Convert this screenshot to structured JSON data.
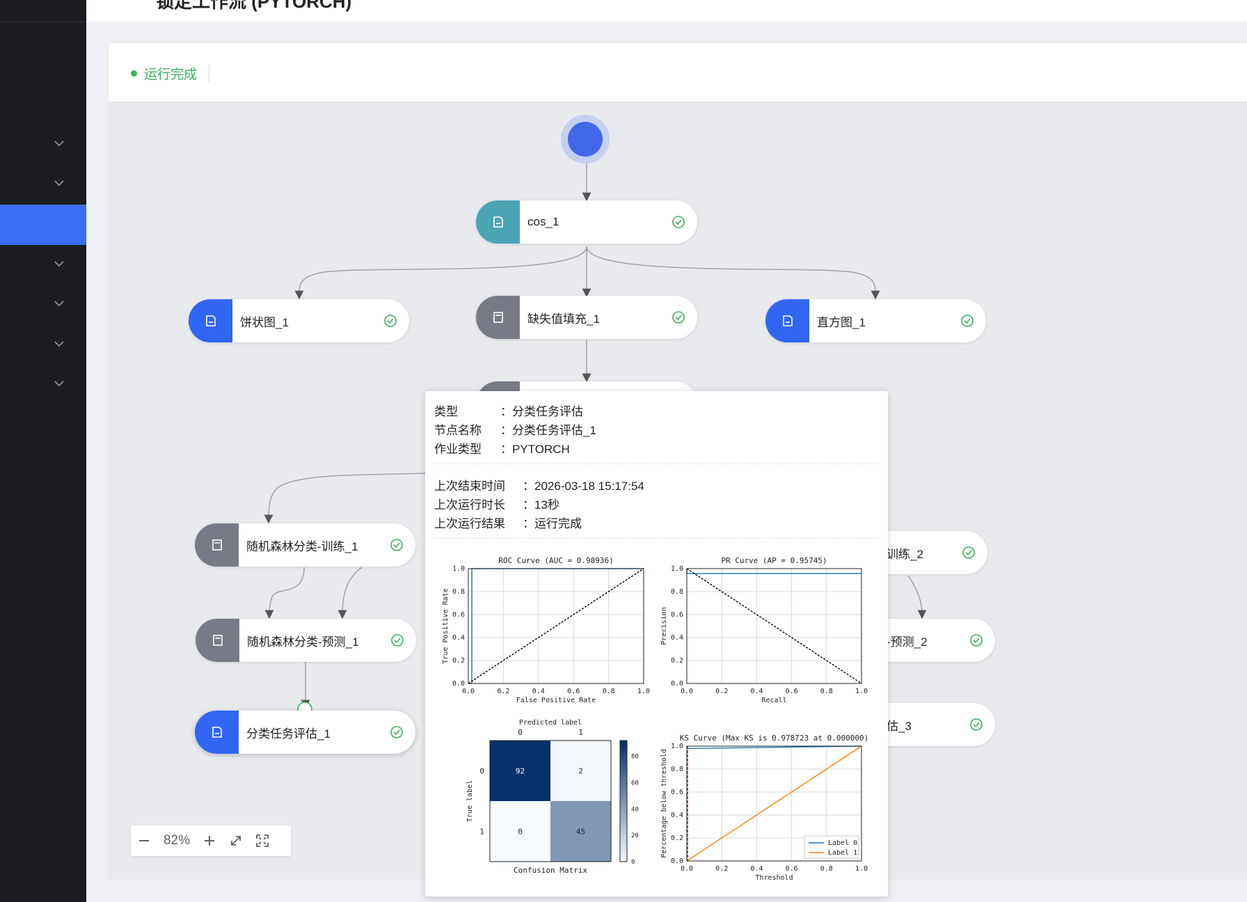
{
  "app": {
    "title_partial": "锁定工作流 (PYTORCH)"
  },
  "sidebar": {
    "items": [
      {
        "icon": "chevron-down-icon",
        "active": false
      },
      {
        "icon": "chevron-down-icon",
        "active": false
      },
      {
        "icon": "",
        "active": true
      },
      {
        "icon": "chevron-down-icon",
        "active": false
      },
      {
        "icon": "chevron-down-icon",
        "active": false
      },
      {
        "icon": "chevron-down-icon",
        "active": false
      },
      {
        "icon": "chevron-down-icon",
        "active": false
      }
    ]
  },
  "status": {
    "label": "运行完成",
    "color": "#38b25c"
  },
  "nodes": {
    "cos": "cos_1",
    "pie": "饼状图_1",
    "fillna": "缺失值填充_1",
    "hist": "直方图_1",
    "rf_train1": "随机森林分类-训练_1",
    "rf_pred1": "随机森林分类-预测_1",
    "eval1": "分类任务评估_1",
    "train2": "训练_2",
    "pred2": "-预测_2",
    "eval3": "估_3"
  },
  "zoom": {
    "level": "82%"
  },
  "tooltip": {
    "rows1": [
      {
        "k": "类型",
        "v": "：分类任务评估"
      },
      {
        "k": "节点名称",
        "v": "：分类任务评估_1"
      },
      {
        "k": "作业类型",
        "v": "：PYTORCH"
      }
    ],
    "rows2": [
      {
        "k": "上次结束时间",
        "v": "：2026-03-18 15:17:54"
      },
      {
        "k": "上次运行时长",
        "v": "：13秒"
      },
      {
        "k": "上次运行结果",
        "v": "：运行完成"
      }
    ]
  },
  "chart_data": [
    {
      "type": "line",
      "title": "ROC Curve (AUC = 0.98936)",
      "xlabel": "False Positive Rate",
      "ylabel": "True Positive Rate",
      "xlim": [
        0,
        1
      ],
      "ylim": [
        0,
        1
      ],
      "grid": true,
      "xticks": [
        "0.0",
        "0.2",
        "0.4",
        "0.6",
        "0.8",
        "1.0"
      ],
      "yticks": [
        "0.0",
        "0.2",
        "0.4",
        "0.6",
        "0.8",
        "1.0"
      ],
      "series": [
        {
          "x": [
            0,
            0.02,
            0.02,
            1
          ],
          "y": [
            0,
            0,
            1,
            1
          ],
          "color": "#1f77b4"
        },
        {
          "x": [
            0,
            1
          ],
          "y": [
            0,
            1
          ],
          "color": "#000000",
          "style": "dashed"
        }
      ]
    },
    {
      "type": "line",
      "title": "PR Curve (AP = 0.95745)",
      "xlabel": "Recall",
      "ylabel": "Precision",
      "xlim": [
        0,
        1
      ],
      "ylim": [
        0,
        1
      ],
      "grid": true,
      "xticks": [
        "0.0",
        "0.2",
        "0.4",
        "0.6",
        "0.8",
        "1.0"
      ],
      "yticks": [
        "0.0",
        "0.2",
        "0.4",
        "0.6",
        "0.8",
        "1.0"
      ],
      "series": [
        {
          "x": [
            0,
            0.0,
            1
          ],
          "y": [
            1.0,
            0.957,
            0.957
          ],
          "color": "#1f77b4"
        },
        {
          "x": [
            0,
            1
          ],
          "y": [
            1,
            0
          ],
          "color": "#000000",
          "style": "dashed"
        }
      ]
    },
    {
      "type": "heatmap",
      "title": "Predicted label",
      "xlabel": "Confusion Matrix",
      "ylabel": "True label",
      "xticks": [
        "0",
        "1"
      ],
      "yticks": [
        "0",
        "1"
      ],
      "values": [
        [
          92,
          2
        ],
        [
          0,
          45
        ]
      ],
      "colorbar_ticks": [
        "0",
        "20",
        "40",
        "60",
        "80"
      ]
    },
    {
      "type": "line",
      "title": "KS Curve (Max KS is 0.978723 at 0.000000)",
      "xlabel": "Threshold",
      "ylabel": "Percentage below threshold",
      "xlim": [
        0,
        1
      ],
      "ylim": [
        0,
        1
      ],
      "grid": true,
      "xticks": [
        "0.0",
        "0.2",
        "0.4",
        "0.6",
        "0.8",
        "1.0"
      ],
      "yticks": [
        "0.0",
        "0.2",
        "0.4",
        "0.6",
        "0.8",
        "1.0"
      ],
      "legend": "lower-right",
      "series": [
        {
          "name": "Label 0",
          "x": [
            0,
            1
          ],
          "y": [
            0.979,
            1.0
          ],
          "color": "#1f77b4"
        },
        {
          "name": "Label 1",
          "x": [
            0,
            1
          ],
          "y": [
            0,
            1
          ],
          "color": "#ff7f0e"
        }
      ],
      "vline": {
        "x": 0.0,
        "color": "#d62728"
      }
    }
  ]
}
